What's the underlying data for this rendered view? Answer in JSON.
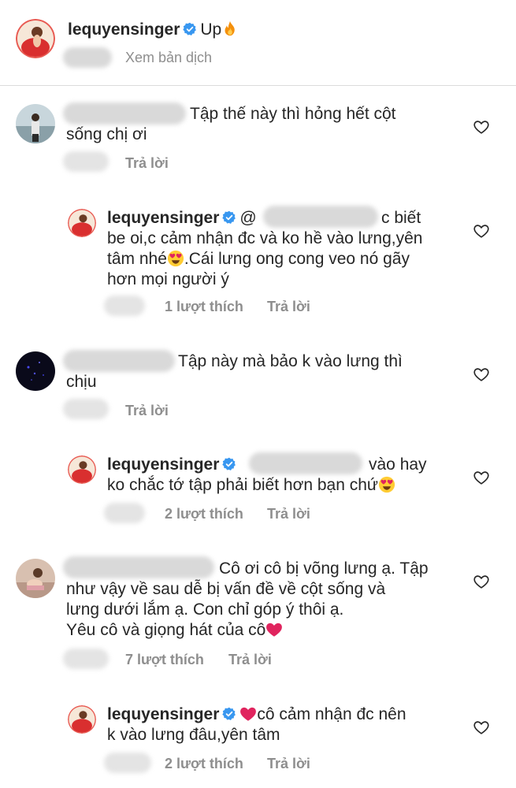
{
  "colors": {
    "text": "#262626",
    "meta": "#8e8e8e",
    "verified": "#3897f0",
    "heart_emoji": "#e0245e"
  },
  "caption": {
    "username": "lequyensinger",
    "text": "Up",
    "emoji": "fire",
    "translate": "Xem bản dịch"
  },
  "comments": [
    {
      "text_line1": "Tập thế này thì hỏng hết cột",
      "text_line2": "sống chị ơi",
      "reply_label": "Trả lời"
    },
    {
      "username": "lequyensinger",
      "text_line1": "c biết",
      "text_line2": "be oi,c cảm nhận đc và ko hề vào lưng,yên",
      "text_line3": "tâm nhé",
      "text_line3b": ".Cái lưng ong cong veo nó gãy",
      "text_line4": "hơn mọi người ý",
      "mention_prefix": "@",
      "likes": "1 lượt thích",
      "reply_label": "Trả lời"
    },
    {
      "text_line1": "Tập này mà bảo k vào lưng thì",
      "text_line2": "chịu",
      "reply_label": "Trả lời"
    },
    {
      "username": "lequyensinger",
      "text_line1": "vào hay",
      "text_line2": "ko chắc tớ tập phải biết hơn bạn chứ",
      "likes": "2 lượt thích",
      "reply_label": "Trả lời"
    },
    {
      "text_line1": "Cô ơi cô bị võng lưng ạ. Tập",
      "text_line2": "như vậy về sau dễ bị vấn đề về cột sống và",
      "text_line3": "lưng dưới lắm ạ. Con chỉ góp ý thôi ạ.",
      "text_line4": "Yêu cô và giọng hát của cô",
      "likes": "7 lượt thích",
      "reply_label": "Trả lời"
    },
    {
      "username": "lequyensinger",
      "text_line1": "cô cảm nhận đc nên",
      "text_line2": "k vào lưng đâu,yên tâm",
      "likes": "2 lượt thích",
      "reply_label": "Trả lời"
    }
  ]
}
